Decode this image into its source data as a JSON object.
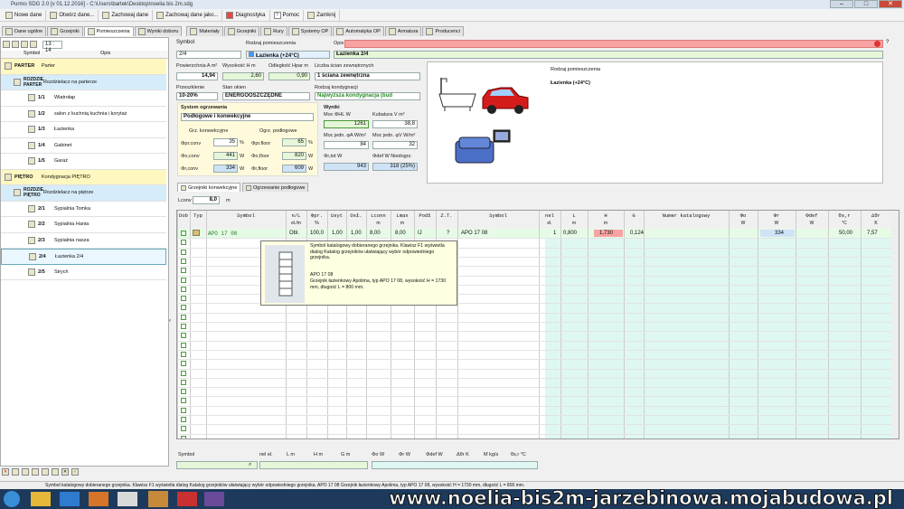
{
  "window": {
    "title": "Purmo SDG 2.0  [v 01.12.2016] - C:\\Users\\bartek\\Desktop\\noelia bis 2m.sdg"
  },
  "menu": [
    {
      "label": "Nowe dane",
      "icon": "new-icon"
    },
    {
      "label": "Otwórz dane...",
      "icon": "folder-open-icon"
    },
    {
      "label": "Zachowaj dane",
      "icon": "save-icon"
    },
    {
      "label": "Zachowaj dane jako...",
      "icon": "save-as-icon"
    },
    {
      "label": "Diagnostyka",
      "icon": "diagnostics-icon"
    },
    {
      "label": "Pomoc",
      "icon": "help-icon"
    },
    {
      "label": "Zamknij",
      "icon": "close-doc-icon"
    }
  ],
  "tabs": [
    "Dane ogólne",
    "Grzejniki",
    "Pomieszczenia",
    "Wyniki doboru",
    "Materiały",
    "Grzejniki",
    "Rury",
    "Systemy OP",
    "Automatyka OP",
    "Armatura",
    "Producenci"
  ],
  "left": {
    "counter": "13 : 14",
    "col_symbol": "Symbol",
    "col_opis": "Opis",
    "rows": [
      {
        "sym": "PARTER",
        "desc": "Parter",
        "kind": "level"
      },
      {
        "sym": "ROZDZIE PARTER",
        "desc": "Rozdzielacz na parterze",
        "kind": "dist"
      },
      {
        "sym": "1/1",
        "desc": "Wiatrołap",
        "kind": "room"
      },
      {
        "sym": "1/2",
        "desc": "salon z kuchnią kuchnia i korytaż",
        "kind": "room"
      },
      {
        "sym": "1/3",
        "desc": "Łazienka",
        "kind": "room"
      },
      {
        "sym": "1/4",
        "desc": "Gabinet",
        "kind": "room"
      },
      {
        "sym": "1/5",
        "desc": "Garaż",
        "kind": "room"
      },
      {
        "sym": "PIĘTRO",
        "desc": "Kondygnacja PIĘTRO",
        "kind": "level"
      },
      {
        "sym": "ROZDZIE PIĘTRO",
        "desc": "Rozdzielacz na piętrze",
        "kind": "dist"
      },
      {
        "sym": "2/1",
        "desc": "Sypialnia Tomka",
        "kind": "room"
      },
      {
        "sym": "2/2",
        "desc": "Sypialnia Hania",
        "kind": "room"
      },
      {
        "sym": "2/3",
        "desc": "Sypialnia nasza",
        "kind": "room"
      },
      {
        "sym": "2/4",
        "desc": "Łazienka 2/4",
        "kind": "selected"
      },
      {
        "sym": "2/5",
        "desc": "Strych",
        "kind": "room"
      }
    ]
  },
  "form": {
    "symbol_label": "Symbol",
    "symbol": "2/4",
    "type_label": "Rodzaj pomieszczenia",
    "type": "Łazienka (+24°C)",
    "opis_label": "Opis",
    "opis": "Łazienka 2/4",
    "area_label": "Powierzchnia A m²",
    "area": "14,94",
    "height_label": "Wysokość H m",
    "height": "2,60",
    "dist_label": "Odległość Hpar m",
    "dist": "0,90",
    "walls_label": "Liczba ścian zewnętrznych",
    "walls": "1 ściana zewnętrzna",
    "przeszklenie_label": "Przeszklenie",
    "przeszklenie": "10-20%",
    "okna_label": "Stan okien",
    "okna": "ENERGOOSZCZĘDNE",
    "kondygnacja_label": "Rodzaj kondygnacji",
    "kondygnacja": "Najwyższa kondygnacja (bud",
    "system_label": "System ogrzewania",
    "system": "Podłogowe i konwekcyjne",
    "grz_konw": "Grz. konwekcyjne",
    "ogrz_podl": "Ogrz. podłogowe",
    "conv_pct_label": "Φpr.conv",
    "conv_pct": "35",
    "floor_pct_label": "Φpr.floor",
    "floor_pct": "65",
    "conv_w_label": "Φo,conv",
    "conv_w": "441",
    "floor_w_label": "Φo,floor",
    "floor_w": "820",
    "conv_calc_label": "Φr,conv",
    "conv_calc": "334",
    "floor_calc_label": "Φr,floor",
    "floor_calc": "609",
    "results_label": "Wyniki",
    "moc_label": "Moc ΦHL W",
    "moc": "1261",
    "kubatura_label": "Kubatura V m³",
    "kubatura": "38,8",
    "mocj_label": "Moc jedn. φA W/m²",
    "mocj": "84",
    "mocjv_label": "Moc jedn. φV W/m³",
    "mocjv": "32",
    "ror_label": "Φr,tot W",
    "ror": "943",
    "def_label": "Φdef W   Niedogrz.",
    "def": "318 (25%)",
    "preview_label": "Rodzaj pomieszczenia",
    "preview_value": "Łazienka (+24°C)",
    "unit_pct": "%",
    "unit_w": "W"
  },
  "subtabs": [
    "Grzejniki konwekcyjne",
    "Ogrzewanie podłogowe"
  ],
  "lconv_label": "Lconv",
  "lconv": "8,0",
  "lconv_unit": "m",
  "grid": {
    "headers": [
      "Dob",
      "Typ",
      "Symbol",
      "n/L",
      "Φpr.",
      "Usyt",
      "Osł.",
      "Lconn",
      "Lmax",
      "Podł",
      "Z.T.",
      "Symbol",
      "nel",
      "L",
      "H",
      "G",
      "Numer katalogowy",
      "Φo",
      "Φr",
      "Φdef",
      "θs,r",
      "Δθr"
    ],
    "units": [
      "",
      "",
      "",
      "el./m",
      "%",
      "",
      "",
      "m",
      "m",
      "",
      "",
      "",
      "el.",
      "m",
      "m",
      "",
      "",
      "W",
      "W",
      "W",
      "°C",
      "K"
    ],
    "row": {
      "symbol": "APO 17 08",
      "nl": "Obl.",
      "pr": "100,0",
      "usyt": "1,00",
      "osl": "1,00",
      "lconn": "8,00",
      "lmax": "8,00",
      "podl": "IJ",
      "zt": "?",
      "symbol2": "APO 17 08",
      "nel": "1",
      "L": "0,800",
      "H": "1,730",
      "G": "0,124",
      "fr": "334",
      "ts": "50,00",
      "dt": "7,57"
    }
  },
  "tooltip": {
    "line1": "Symbol katalogowy dobieranego grzejnika. Klawisz F1 wyświetla dialog Katalog grzejników ułatwiający wybór odpowiedniego grzejnika.",
    "line2": "APO 17 08",
    "line3": "Grzejnik łazienkowy Apolima, typ APO 17 08, wysokość H = 1730 mm, długość L = 800 mm."
  },
  "bottom_labels": [
    "Symbol",
    "nel el.",
    "L m",
    "H m",
    "G m",
    "Φo W",
    "Φr W",
    "Φdef W",
    "Δθr K",
    "M kg/s",
    "θs,r °C"
  ],
  "status": "Symbol katalogowy dobieranego grzejnika. Klawisz F1 wyświetla dialog Katalog grzejników ułatwiający wybór odpowiedniego grzejnika.   APO 17 08  Grzejnik łazienkowy Apolima, typ APO 17 08, wysokość H = 1730 mm, długość L = 800 mm.",
  "watermark": "www.noelia-bis2m-jarzebinowa.mojabudowa.pl",
  "colors": {
    "accent_green": "#e5f7d8",
    "level_yellow": "#fff7c0",
    "dist_blue": "#d6ecfa",
    "opis_red": "#f7a3a3"
  }
}
